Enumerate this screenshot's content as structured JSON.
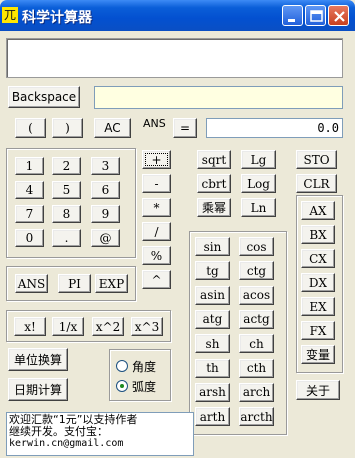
{
  "window": {
    "title": "科学计算器",
    "app_icon_glyph": "兀"
  },
  "display": {
    "input_value": "",
    "result_value": "0.0",
    "memory_value": ""
  },
  "top_row": {
    "backspace": "Backspace",
    "open_paren": "(",
    "close_paren": ")",
    "ac": "AC",
    "ans_label": "ANS",
    "equals": "="
  },
  "digits": [
    "1",
    "2",
    "3",
    "4",
    "5",
    "6",
    "7",
    "8",
    "9",
    "0",
    ".",
    "@"
  ],
  "operators": [
    "+",
    "-",
    "*",
    "/",
    "%",
    "^"
  ],
  "ans_group": [
    "ANS",
    "PI",
    "EXP"
  ],
  "power_group": [
    "x!",
    "1/x",
    "x^2",
    "x^3"
  ],
  "func_top": [
    "sqrt",
    "Lg",
    "cbrt",
    "Log",
    "乘幂",
    "Ln"
  ],
  "trig": [
    "sin",
    "cos",
    "tg",
    "ctg",
    "asin",
    "acos",
    "atg",
    "actg",
    "sh",
    "ch",
    "th",
    "cth",
    "arsh",
    "arch",
    "arth",
    "arcth"
  ],
  "memory": [
    "STO",
    "CLR"
  ],
  "registers": [
    "AX",
    "BX",
    "CX",
    "DX",
    "EX",
    "FX",
    "变量"
  ],
  "about": "关于",
  "unit_convert": "单位换算",
  "date_calc": "日期计算",
  "angle": {
    "degree": "角度",
    "radian": "弧度",
    "selected": "radian"
  },
  "info_text": [
    "欢迎汇款“1元”以支持作者",
    "继续开发。支付宝：",
    "kerwin.cn@gmail.com"
  ],
  "colors": {
    "titlebar": "#0350d0",
    "window_bg": "#ece9d8",
    "memory_field": "#ffffe1"
  }
}
